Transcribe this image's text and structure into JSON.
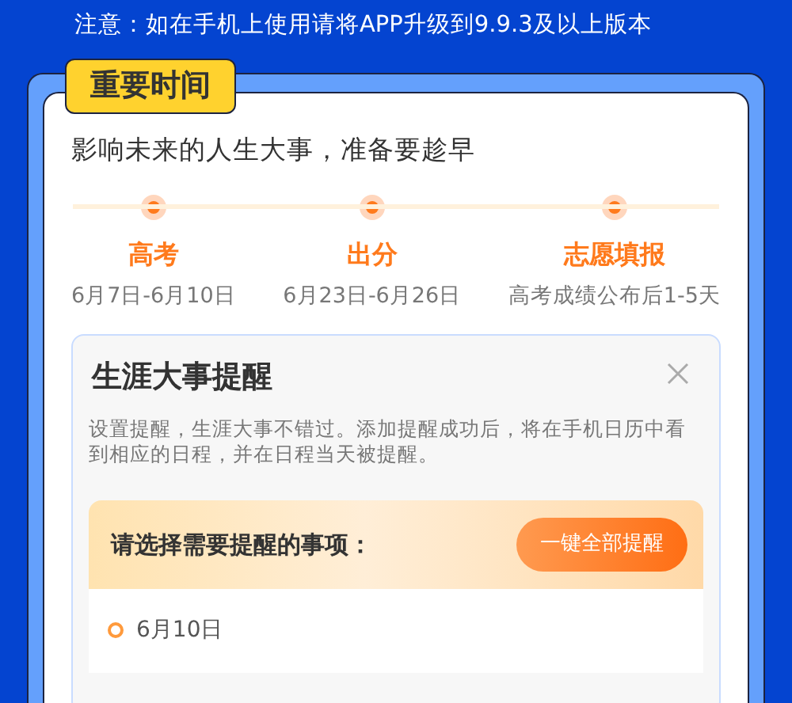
{
  "notice": "注意：如在手机上使用请将APP升级到9.9.3及以上版本",
  "section": {
    "badge": "重要时间",
    "subtitle": "影响未来的人生大事，准备要趁早",
    "milestones": [
      {
        "title": "高考",
        "date": "6月7日-6月10日"
      },
      {
        "title": "出分",
        "date": "6月23日-6月26日"
      },
      {
        "title": "志愿填报",
        "date": "高考成绩公布后1-5天"
      }
    ]
  },
  "reminder": {
    "title": "生涯大事提醒",
    "description": "设置提醒，生涯大事不错过。添加提醒成功后，将在手机日历中看到相应的日程，并在日程当天被提醒。",
    "prompt": "请选择需要提醒的事项：",
    "button": "一键全部提醒",
    "items": [
      {
        "date": "6月10日"
      }
    ]
  }
}
